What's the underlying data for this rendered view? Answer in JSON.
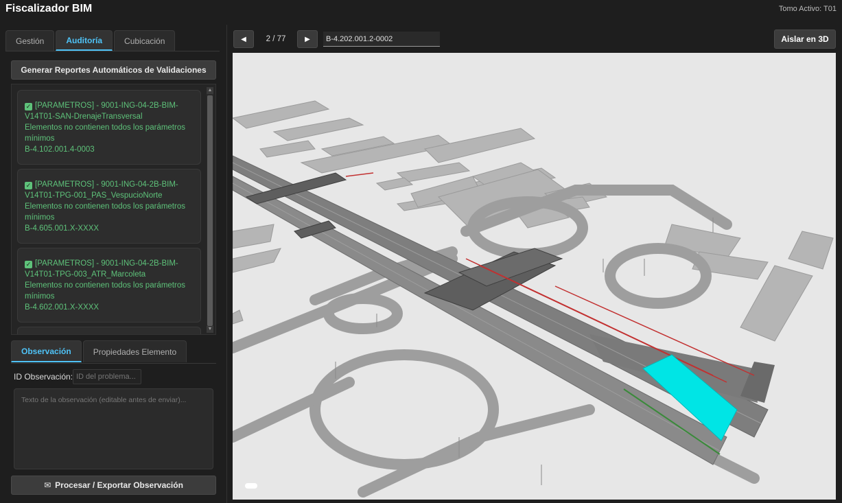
{
  "header": {
    "title": "Fiscalizador BIM",
    "tomo_activo": "Tomo Activo: T01"
  },
  "tabs": [
    {
      "label": "Gestión",
      "active": false
    },
    {
      "label": "Auditoría",
      "active": true
    },
    {
      "label": "Cubicación",
      "active": false
    }
  ],
  "generate_button": "Generar Reportes Automáticos de Validaciones",
  "validations": [
    {
      "line1": "[PARAMETROS] - 9001-ING-04-2B-BIM-",
      "line2": "V14T01-SAN-DrenajeTransversal",
      "line3": "Elementos no contienen todos los parámetros",
      "line4": "mínimos",
      "line5": "B-4.102.001.4-0003"
    },
    {
      "line1": "[PARAMETROS] - 9001-ING-04-2B-BIM-",
      "line2": "V14T01-TPG-001_PAS_VespucioNorte",
      "line3": "Elementos no contienen todos los parámetros",
      "line4": "mínimos",
      "line5": "B-4.605.001.X-XXXX"
    },
    {
      "line1": "[PARAMETROS] - 9001-ING-04-2B-BIM-",
      "line2": "V14T01-TPG-003_ATR_Marcoleta",
      "line3": "Elementos no contienen todos los parámetros",
      "line4": "mínimos",
      "line5": "B-4.602.001.X-XXXX"
    }
  ],
  "subtabs": [
    {
      "label": "Observación",
      "active": true
    },
    {
      "label": "Propiedades Elemento",
      "active": false
    }
  ],
  "observation": {
    "id_label": "ID Observación:",
    "id_placeholder": "ID del problema...",
    "text_placeholder": "Texto de la observación (editable antes de enviar)..."
  },
  "process_button": {
    "icon": "envelope-icon",
    "label": "Procesar / Exportar Observación"
  },
  "viewer": {
    "prev_icon": "triangle-left-icon",
    "next_icon": "triangle-right-icon",
    "page_counter": "2 / 77",
    "element_id": "B-4.202.001.2-0002",
    "isolate_button": "Aislar en 3D"
  },
  "colors": {
    "accent": "#4fc3f7",
    "validation_text": "#5ec27a",
    "highlight_element": "#00e5e5"
  }
}
